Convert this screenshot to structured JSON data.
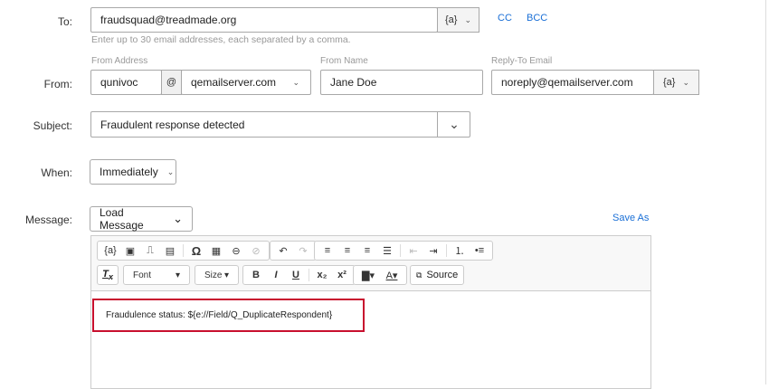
{
  "labels": {
    "to": "To:",
    "from": "From:",
    "subject": "Subject:",
    "when": "When:",
    "message": "Message:"
  },
  "to": {
    "value": "fraudsquad@treadmade.org",
    "piped": "{a}",
    "cc": "CC",
    "bcc": "BCC",
    "helper": "Enter up to 30 email addresses, each separated by a comma."
  },
  "from": {
    "address_label": "From Address",
    "address_local": "qunivoc",
    "at": "@",
    "domain": "qemailserver.com",
    "name_label": "From Name",
    "name": "Jane Doe",
    "reply_label": "Reply-To Email",
    "reply": "noreply@qemailserver.com",
    "piped": "{a}"
  },
  "subject": {
    "value": "Fraudulent response detected"
  },
  "when": {
    "value": "Immediately"
  },
  "message": {
    "load": "Load Message",
    "save_as": "Save As"
  },
  "toolbar": {
    "piped": "{a}",
    "font": "Font",
    "size": "Size",
    "bold": "B",
    "italic": "I",
    "underline": "U",
    "source": "Source"
  },
  "editor": {
    "content": "Fraudulence status: ${e://Field/Q_DuplicateRespondent}"
  },
  "colors": {
    "link": "#1a6fd6",
    "highlight": "#c8102e"
  }
}
